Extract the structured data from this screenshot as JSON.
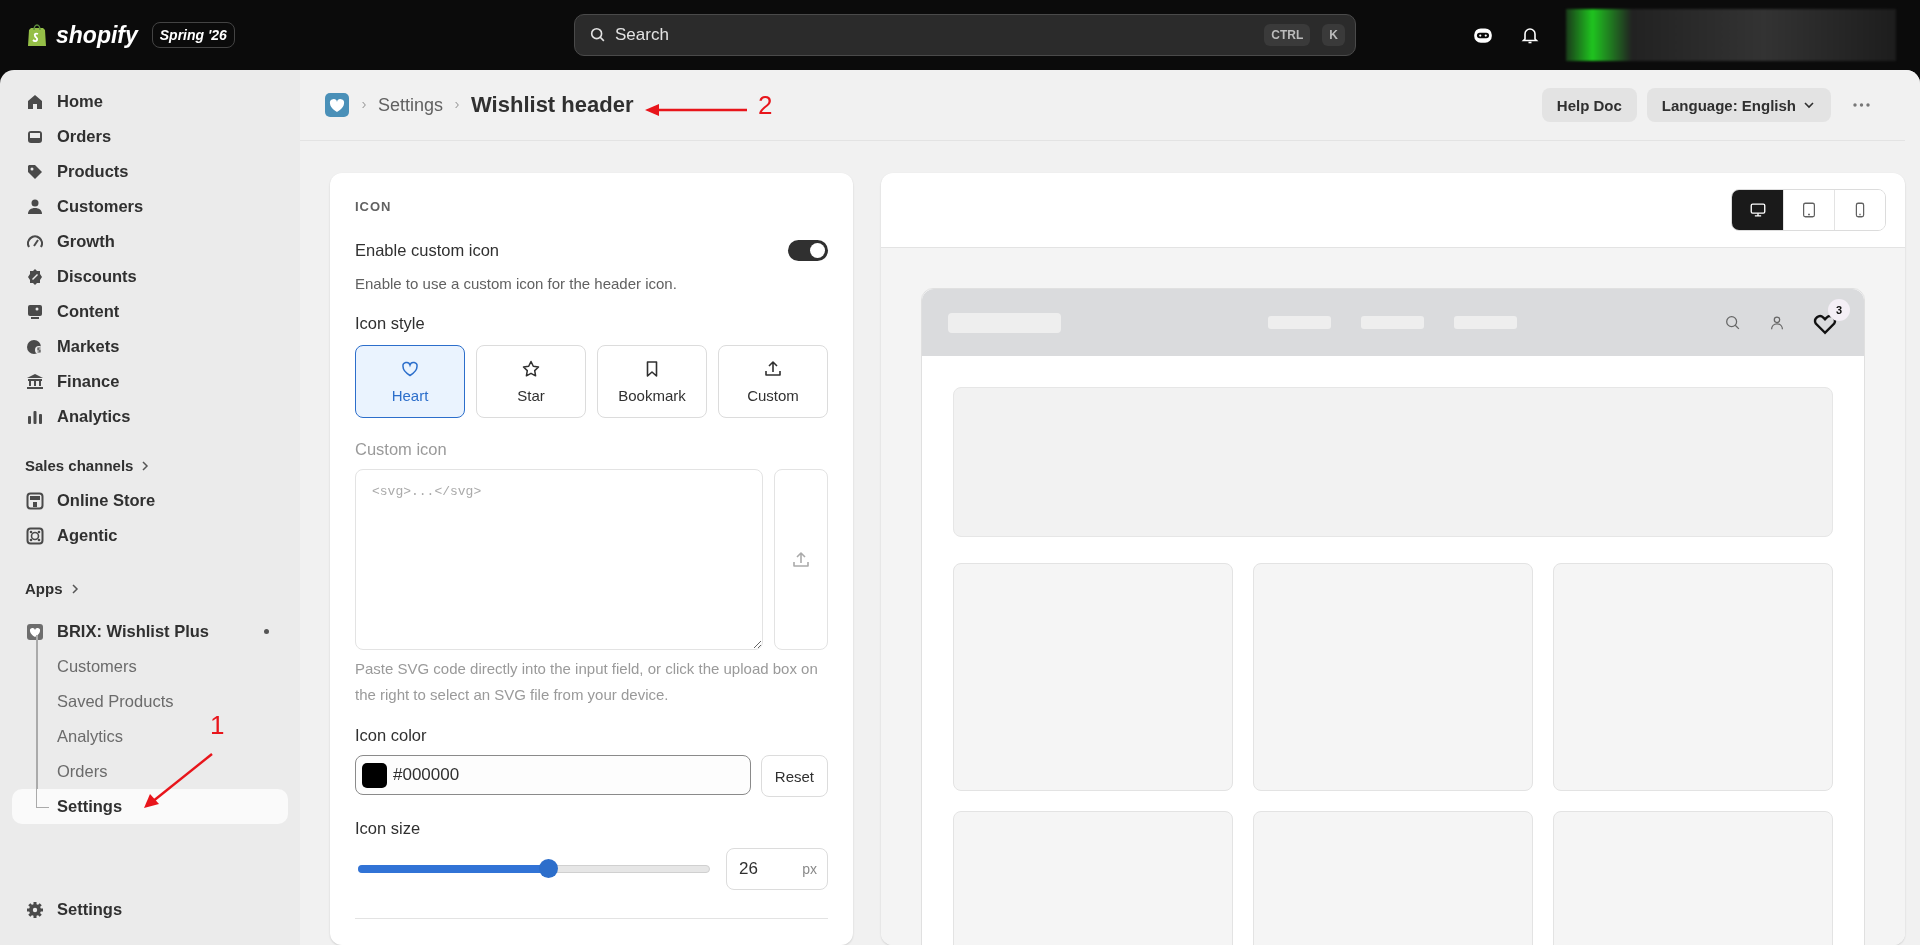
{
  "topbar": {
    "logo_text": "shopify",
    "edition": "Spring '26",
    "search": {
      "placeholder": "Search"
    },
    "shortcut_keys": [
      "CTRL",
      "K"
    ]
  },
  "sidebar": {
    "main_items": [
      {
        "label": "Home",
        "kind": "home"
      },
      {
        "label": "Orders",
        "kind": "inbox"
      },
      {
        "label": "Products",
        "kind": "tag"
      },
      {
        "label": "Customers",
        "kind": "person"
      },
      {
        "label": "Growth",
        "kind": "gauge"
      },
      {
        "label": "Discounts",
        "kind": "discount"
      },
      {
        "label": "Content",
        "kind": "image"
      },
      {
        "label": "Markets",
        "kind": "globe"
      },
      {
        "label": "Finance",
        "kind": "bank"
      },
      {
        "label": "Analytics",
        "kind": "bars"
      }
    ],
    "sales_channels": {
      "heading": "Sales channels",
      "items": [
        {
          "label": "Online Store",
          "kind": "store"
        },
        {
          "label": "Agentic",
          "kind": "agent"
        }
      ]
    },
    "apps": {
      "heading": "Apps",
      "app": {
        "name": "BRIX: Wishlist Plus",
        "items": [
          {
            "label": "Customers",
            "selected": false
          },
          {
            "label": "Saved Products",
            "selected": false
          },
          {
            "label": "Analytics",
            "selected": false
          },
          {
            "label": "Orders",
            "selected": false
          },
          {
            "label": "Settings",
            "selected": true
          }
        ]
      }
    },
    "footer_item": {
      "label": "Settings"
    }
  },
  "header": {
    "breadcrumb": [
      "Settings"
    ],
    "title": "Wishlist header",
    "help_button": "Help Doc",
    "language_button": "Language: English"
  },
  "settings": {
    "section_title": "ICON",
    "custom_toggle": {
      "label": "Enable custom icon",
      "on": true,
      "description": "Enable to use a custom icon for the header icon."
    },
    "icon_style": {
      "label": "Icon style",
      "options": [
        {
          "label": "Heart",
          "kind": "heart",
          "selected": true
        },
        {
          "label": "Star",
          "kind": "star",
          "selected": false
        },
        {
          "label": "Bookmark",
          "kind": "bookmark",
          "selected": false
        },
        {
          "label": "Custom",
          "kind": "upload",
          "selected": false
        }
      ]
    },
    "custom_icon": {
      "label": "Custom icon",
      "disabled": true,
      "placeholder": "<svg>...</svg>",
      "help": "Paste SVG code directly into the input field, or click the upload box on the right to select an SVG file from your device."
    },
    "icon_color": {
      "label": "Icon color",
      "value": "#000000",
      "color": "#000000",
      "reset": "Reset"
    },
    "icon_size": {
      "label": "Icon size",
      "level": 0.54,
      "value": "26",
      "unit": "px"
    }
  },
  "preview": {
    "devices": [
      {
        "kind": "desktop",
        "selected": true
      },
      {
        "kind": "tablet",
        "selected": false
      },
      {
        "kind": "mobile",
        "selected": false
      }
    ],
    "wishlist_count": "3"
  },
  "annotations": [
    {
      "label": "1",
      "kind": "sidebar"
    },
    {
      "label": "2",
      "kind": "title"
    }
  ]
}
